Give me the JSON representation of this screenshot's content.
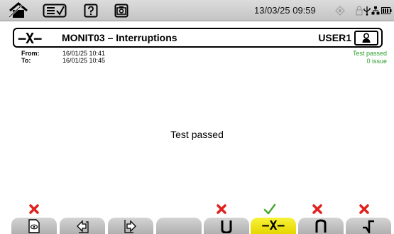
{
  "topbar": {
    "datetime": "13/03/25 09:59"
  },
  "header": {
    "mode_symbol": "−X−",
    "title": "MONIT03 – Interruptions",
    "user": "USER1"
  },
  "info": {
    "from_label": "From:",
    "from_value": "16/01/25 10:41",
    "to_label": "To:",
    "to_value": "16/01/25 10:45",
    "status": "Test passed",
    "issues": "0 issue"
  },
  "main": {
    "message": "Test passed"
  },
  "softkeys": {
    "interruptions_glyph": "−X−"
  },
  "colors": {
    "pass": "#2e9e2e",
    "fail": "#e0201c",
    "active_key": "#f0e600"
  }
}
